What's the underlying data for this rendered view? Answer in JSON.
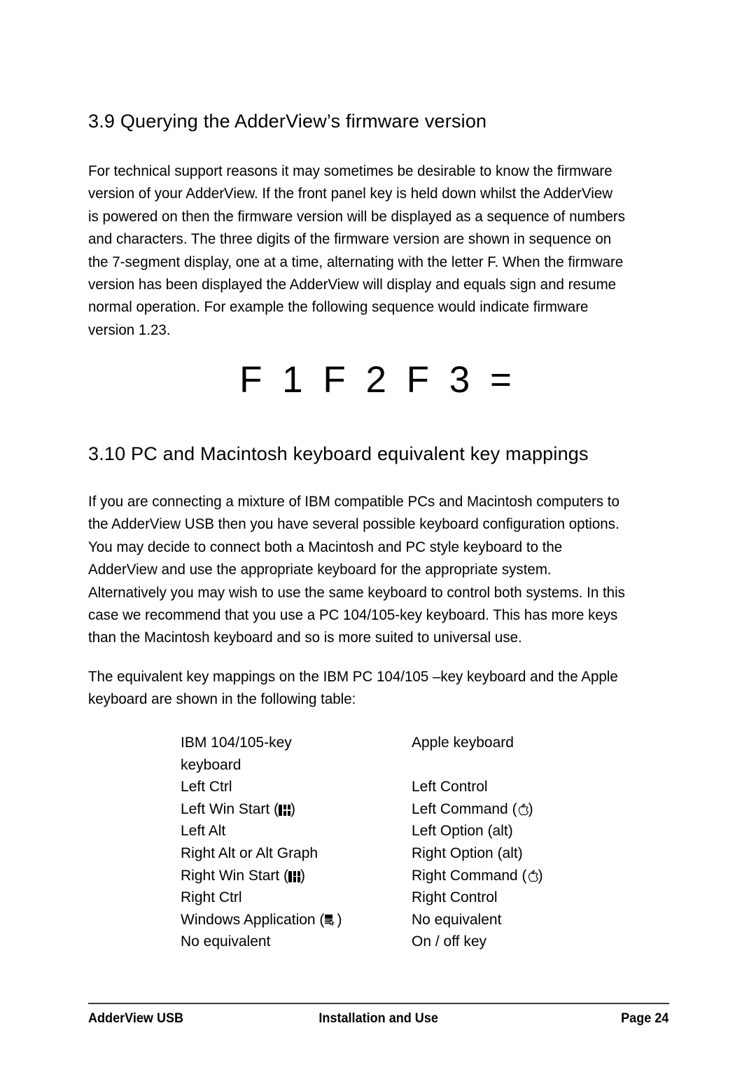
{
  "document": {
    "section_39": {
      "heading": "3.9 Querying the AdderView’s firmware version",
      "paragraph_lines": [
        "For technical support reasons it may sometimes be desirable to know the firmware",
        "version of your AdderView. If the front panel key is held down whilst the AdderView",
        "is powered on then the firmware version will be displayed as a sequence of numbers",
        "and characters. The three digits of the firmware version are shown in sequence on",
        "the 7-segment display, one at a time, alternating with the letter F. When the firmware",
        "version has been displayed the AdderView will display and equals sign and resume",
        "normal operation. For example the following sequence would indicate firmware",
        "version 1.23."
      ],
      "firmware_sequence": "F 1 F 2 F 3 ="
    },
    "section_310": {
      "heading": "3.10 PC and Macintosh keyboard equivalent key mappings",
      "paragraph_a_lines": [
        "If you are connecting a mixture of IBM compatible PCs and Macintosh computers to",
        "the AdderView USB then you have several possible keyboard configuration options.",
        "You may decide to connect both a Macintosh and PC style keyboard to the",
        "AdderView and use the appropriate keyboard for the appropriate system.",
        "Alternatively you may wish to use the same keyboard to control both systems. In this",
        "case we recommend that you use a PC 104/105-key keyboard. This has more keys",
        "than the Macintosh keyboard and so is more suited to universal use."
      ],
      "paragraph_b_lines": [
        "The equivalent key mappings on the IBM PC 104/105 –key keyboard and the Apple",
        "keyboard are shown in the following table:"
      ],
      "key_table": {
        "header": {
          "column1_line1": "IBM 104/105-key",
          "column1_line2": "keyboard",
          "column2": "Apple keyboard"
        },
        "rows": [
          {
            "ibm_prefix": "Left Ctrl",
            "ibm_icon": "",
            "ibm_suffix": "",
            "apple_prefix": "Left Control",
            "apple_icon": "",
            "apple_suffix": ""
          },
          {
            "ibm_prefix": "Left Win Start (",
            "ibm_icon": "windows-logo-icon",
            "ibm_suffix": ")",
            "apple_prefix": "Left Command (",
            "apple_icon": "apple-logo-icon",
            "apple_suffix": ")"
          },
          {
            "ibm_prefix": "Left Alt",
            "ibm_icon": "",
            "ibm_suffix": "",
            "apple_prefix": "Left Option (alt)",
            "apple_icon": "",
            "apple_suffix": ""
          },
          {
            "ibm_prefix": "Right Alt or Alt Graph",
            "ibm_icon": "",
            "ibm_suffix": "",
            "apple_prefix": "Right Option (alt)",
            "apple_icon": "",
            "apple_suffix": ""
          },
          {
            "ibm_prefix": "Right Win Start (",
            "ibm_icon": "windows-logo-icon",
            "ibm_suffix": ")",
            "apple_prefix": "Right Command (",
            "apple_icon": "apple-logo-icon",
            "apple_suffix": ")"
          },
          {
            "ibm_prefix": "Right Ctrl",
            "ibm_icon": "",
            "ibm_suffix": "",
            "apple_prefix": "Right Control",
            "apple_icon": "",
            "apple_suffix": ""
          },
          {
            "ibm_prefix": "Windows Application (",
            "ibm_icon": "windows-application-key-icon",
            "ibm_suffix": ")",
            "apple_prefix": "No equivalent",
            "apple_icon": "",
            "apple_suffix": ""
          },
          {
            "ibm_prefix": "No equivalent",
            "ibm_icon": "",
            "ibm_suffix": "",
            "apple_prefix": "On / off key",
            "apple_icon": "",
            "apple_suffix": ""
          }
        ]
      }
    },
    "footer": {
      "left": "AdderView USB",
      "center": "Installation and Use",
      "right": "Page 24"
    }
  }
}
